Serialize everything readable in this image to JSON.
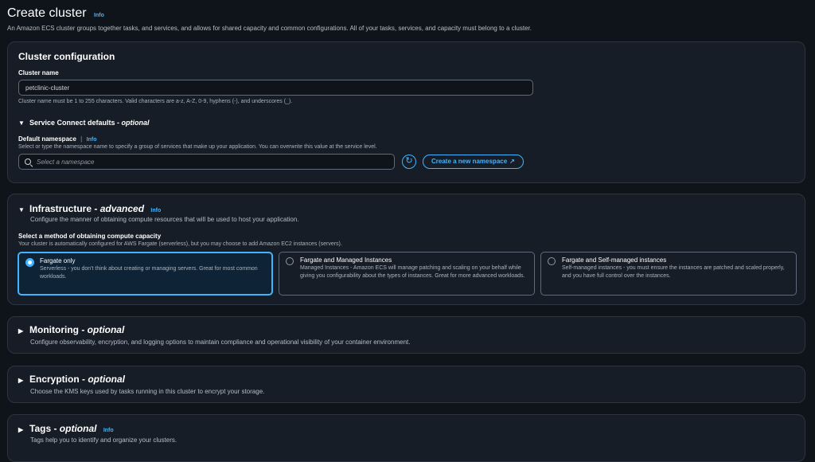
{
  "page": {
    "title": "Create cluster",
    "info": "Info",
    "description": "An Amazon ECS cluster groups together tasks, and services, and allows for shared capacity and common configurations. All of your tasks, services, and capacity must belong to a cluster."
  },
  "cluster_config": {
    "heading": "Cluster configuration",
    "name_label": "Cluster name",
    "name_value": "petclinic-cluster",
    "name_hint": "Cluster name must be 1 to 255 characters. Valid characters are a-z, A-Z, 0-9, hyphens (-), and underscores (_).",
    "service_connect": {
      "heading": "Service Connect defaults",
      "optional": "optional",
      "namespace_label": "Default namespace",
      "info": "Info",
      "namespace_hint": "Select or type the namespace name to specify a group of services that make up your application. You can overwrite this value at the service level.",
      "namespace_placeholder": "Select a namespace",
      "create_button": "Create a new namespace"
    }
  },
  "infrastructure": {
    "heading": "Infrastructure",
    "advanced": "advanced",
    "info": "Info",
    "description": "Configure the manner of obtaining compute resources that will be used to host your application.",
    "method_label": "Select a method of obtaining compute capacity",
    "method_hint": "Your cluster is automatically configured for AWS Fargate (serverless), but you may choose to add Amazon EC2 instances (servers).",
    "options": [
      {
        "title": "Fargate only",
        "description": "Serverless - you don't think about creating or managing servers. Great for most common workloads.",
        "selected": true
      },
      {
        "title": "Fargate and Managed Instances",
        "description": "Managed Instances - Amazon ECS will manage patching and scaling on your behalf while giving you configurability about the types of instances. Great for more advanced workloads.",
        "selected": false
      },
      {
        "title": "Fargate and Self-managed instances",
        "description": "Self-managed instances - you must ensure the instances are patched and scaled properly, and you have full control over the instances.",
        "selected": false
      }
    ]
  },
  "monitoring": {
    "heading": "Monitoring",
    "optional": "optional",
    "description": "Configure observability, encryption, and logging options to maintain compliance and operational visibility of your container environment."
  },
  "encryption": {
    "heading": "Encryption",
    "optional": "optional",
    "description": "Choose the KMS keys used by tasks running in this cluster to encrypt your storage."
  },
  "tags": {
    "heading": "Tags",
    "optional": "optional",
    "info": "Info",
    "description": "Tags help you to identify and organize your clusters."
  },
  "colors": {
    "accent": "#42b4ff",
    "background": "#0f141a",
    "panel": "#161d26"
  }
}
